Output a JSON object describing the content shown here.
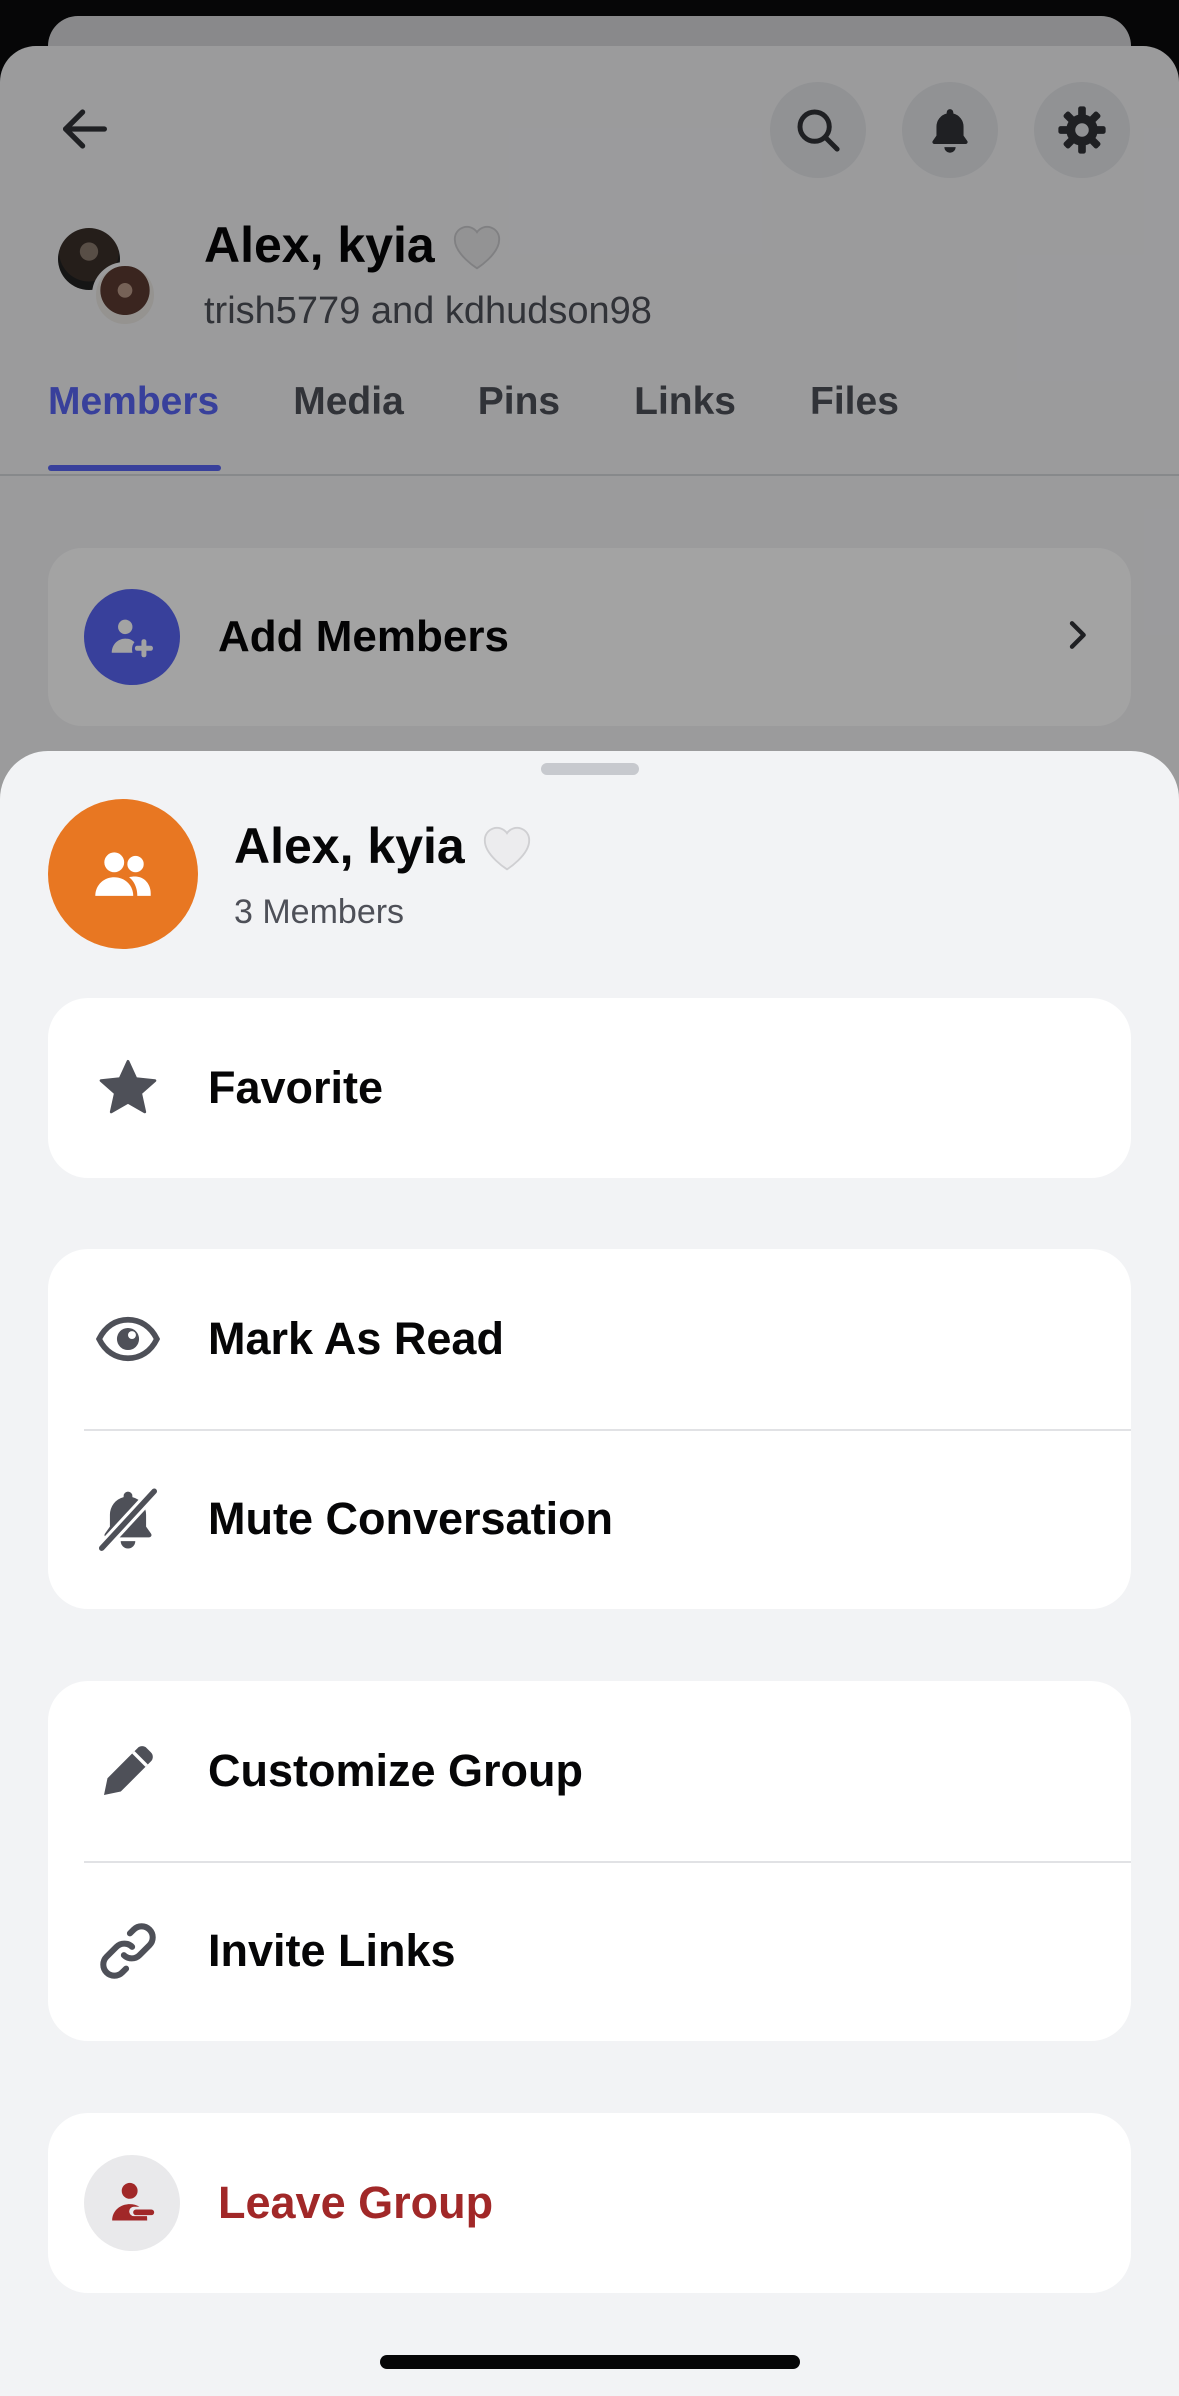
{
  "background": {
    "title": "Alex, kyia",
    "title_emoji": "🤍",
    "subtitle": "trish5779 and kdhudson98",
    "tabs": [
      "Members",
      "Media",
      "Pins",
      "Links",
      "Files"
    ],
    "active_tab": "Members",
    "add_members_label": "Add Members"
  },
  "sheet": {
    "title": "Alex, kyia",
    "title_emoji": "🤍",
    "member_count": "3 Members",
    "favorite_label": "Favorite",
    "mark_read_label": "Mark As Read",
    "mute_label": "Mute Conversation",
    "customize_label": "Customize Group",
    "invite_label": "Invite Links",
    "leave_label": "Leave Group"
  },
  "colors": {
    "accent": "#5865f2",
    "group_avatar": "#e87722",
    "danger": "#a12828"
  },
  "icons": {
    "back": "arrow-left-icon",
    "search": "search-icon",
    "bell": "bell-icon",
    "settings": "gear-icon",
    "add_member": "add-member-icon",
    "favorite": "star-icon",
    "mark_read": "eye-icon",
    "mute": "bell-slash-icon",
    "customize": "pencil-icon",
    "invite": "link-icon",
    "leave": "leave-icon"
  }
}
